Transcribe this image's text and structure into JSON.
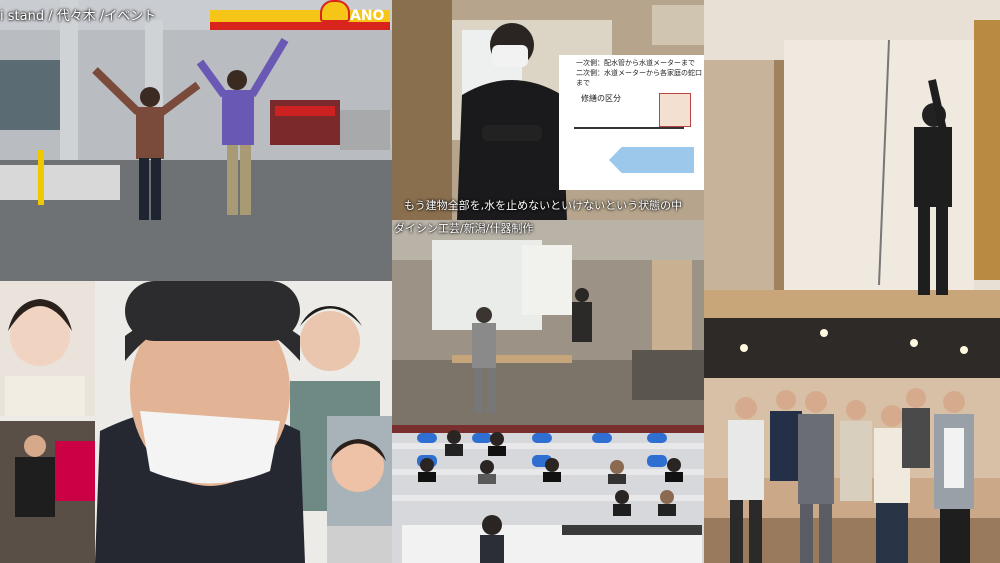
{
  "collage": {
    "tiles": [
      {
        "id": "gas-station",
        "caption": "i stand / 代々木 /イベント",
        "sign_brand": "ANO"
      },
      {
        "id": "interview-masked-man",
        "subtitle": "もう建物全部を,水を止めないといけないという状態の中",
        "diagram": {
          "line1": "一次側：配水管から水道メーターまで",
          "line2": "二次側：水道メーターから各家庭の蛇口まで",
          "title": "修繕の区分"
        }
      },
      {
        "id": "white-room",
        "caption": ""
      },
      {
        "id": "video-call",
        "caption": ""
      },
      {
        "id": "workshop",
        "caption": "ダイシン工芸/新潟/什器制作"
      },
      {
        "id": "lecture-hall",
        "caption": ""
      },
      {
        "id": "group-photo",
        "caption": ""
      }
    ]
  },
  "colors": {
    "shell_yellow": "#f5c518",
    "shell_red": "#d9231d",
    "wall_beige": "#e8e0d4"
  }
}
